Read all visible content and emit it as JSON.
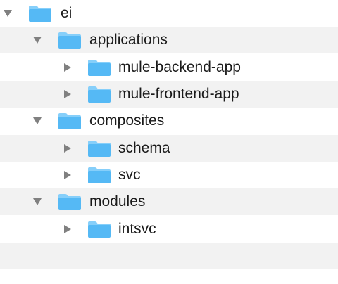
{
  "colors": {
    "folder_front": "#55b9f5",
    "folder_back": "#86cffa",
    "disclosure": "#808080",
    "stripe": "#f2f2f2",
    "text": "#1a1a1a"
  },
  "tree": {
    "items": [
      {
        "label": "ei",
        "expanded": true,
        "icon": "folder-icon"
      },
      {
        "label": "applications",
        "expanded": true,
        "icon": "folder-icon"
      },
      {
        "label": "mule-backend-app",
        "expanded": false,
        "icon": "folder-icon"
      },
      {
        "label": "mule-frontend-app",
        "expanded": false,
        "icon": "folder-icon"
      },
      {
        "label": "composites",
        "expanded": true,
        "icon": "folder-icon"
      },
      {
        "label": "schema",
        "expanded": false,
        "icon": "folder-icon"
      },
      {
        "label": "svc",
        "expanded": false,
        "icon": "folder-icon"
      },
      {
        "label": "modules",
        "expanded": true,
        "icon": "folder-icon"
      },
      {
        "label": "intsvc",
        "expanded": false,
        "icon": "folder-icon"
      }
    ]
  }
}
